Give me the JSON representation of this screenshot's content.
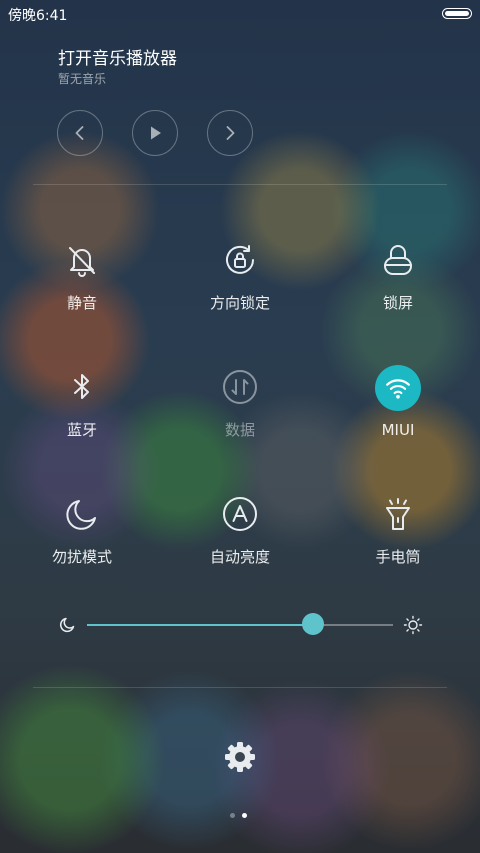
{
  "status_bar": {
    "time": "傍晚6:41"
  },
  "music": {
    "title": "打开音乐播放器",
    "subtitle": "暂无音乐",
    "controls": [
      "chevron-left-icon",
      "play-icon",
      "chevron-right-icon"
    ]
  },
  "toggles": [
    {
      "label": "静音",
      "icon": "bell-off-icon",
      "state": "off"
    },
    {
      "label": "方向锁定",
      "icon": "rotation-lock-icon",
      "state": "off"
    },
    {
      "label": "锁屏",
      "icon": "lock-icon",
      "state": "off"
    },
    {
      "label": "蓝牙",
      "icon": "bluetooth-icon",
      "state": "off"
    },
    {
      "label": "数据",
      "icon": "mobile-data-icon",
      "state": "disabled"
    },
    {
      "label": "MIUI",
      "icon": "wifi-icon",
      "state": "on"
    },
    {
      "label": "勿扰模式",
      "icon": "moon-icon",
      "state": "off"
    },
    {
      "label": "自动亮度",
      "icon": "auto-brightness-icon",
      "state": "off"
    },
    {
      "label": "手电筒",
      "icon": "flashlight-icon",
      "state": "off"
    }
  ],
  "brightness": {
    "level_fraction": 0.74
  },
  "colors": {
    "accent": "#1cb8c4",
    "slider": "#5fc3cc"
  },
  "pager": {
    "count": 2,
    "active_index": 1
  }
}
